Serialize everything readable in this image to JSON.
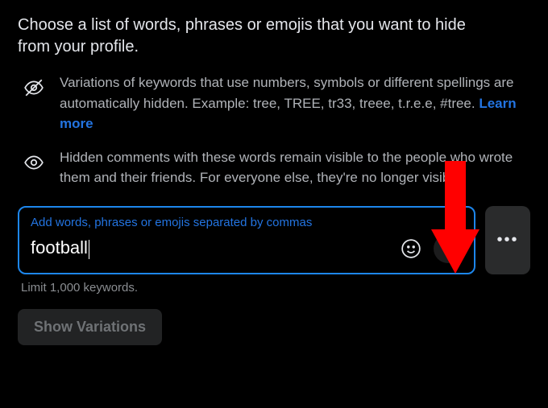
{
  "intro": "Choose a list of words, phrases or emojis that you want to hide from your profile.",
  "info1": {
    "text_before_link": "Variations of keywords that use numbers, symbols or different spellings are automatically hidden. Example: tree, TREE, tr33, treee, t.r.e.e, #tree. ",
    "link_text": "Learn more"
  },
  "info2": "Hidden comments with these words remain visible to the people who wrote them and their friends. For everyone else, they're no longer visible.",
  "input": {
    "label": "Add words, phrases or emojis separated by commas",
    "value": "football"
  },
  "limit_text": "Limit 1,000 keywords.",
  "show_variations_label": "Show Variations",
  "more_dots": "•••"
}
